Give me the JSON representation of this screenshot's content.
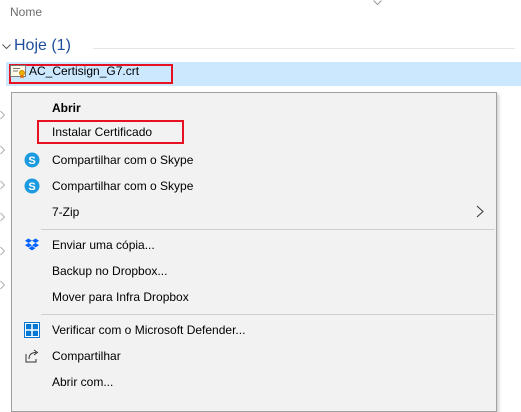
{
  "header": {
    "name_column": "Nome"
  },
  "group": {
    "label": "Hoje (1)"
  },
  "file": {
    "name": "AC_Certisign_G7.crt"
  },
  "context_menu": {
    "items": [
      {
        "label": "Abrir",
        "bold": true,
        "icon": "none"
      },
      {
        "label": "Instalar Certificado",
        "icon": "none"
      },
      {
        "label": "Compartilhar com o Skype",
        "icon": "skype-icon"
      },
      {
        "label": "Compartilhar com o Skype",
        "icon": "skype-icon"
      },
      {
        "label": "7-Zip",
        "icon": "none",
        "submenu": true
      },
      {
        "label": "Enviar uma cópia...",
        "icon": "dropbox-icon"
      },
      {
        "label": "Backup no Dropbox...",
        "icon": "none"
      },
      {
        "label": "Mover para Infra Dropbox",
        "icon": "none"
      },
      {
        "label": "Verificar com o Microsoft Defender...",
        "icon": "defender-icon"
      },
      {
        "label": "Compartilhar",
        "icon": "share-icon"
      },
      {
        "label": "Abrir com...",
        "icon": "none"
      }
    ]
  },
  "colors": {
    "selection": "#cce8ff",
    "highlight_border": "#e81123",
    "group_text": "#1f4e9c",
    "menu_bg": "#f2f2f2",
    "skype": "#1c9ae0",
    "dropbox": "#0061fe",
    "defender": "#0078d4"
  }
}
